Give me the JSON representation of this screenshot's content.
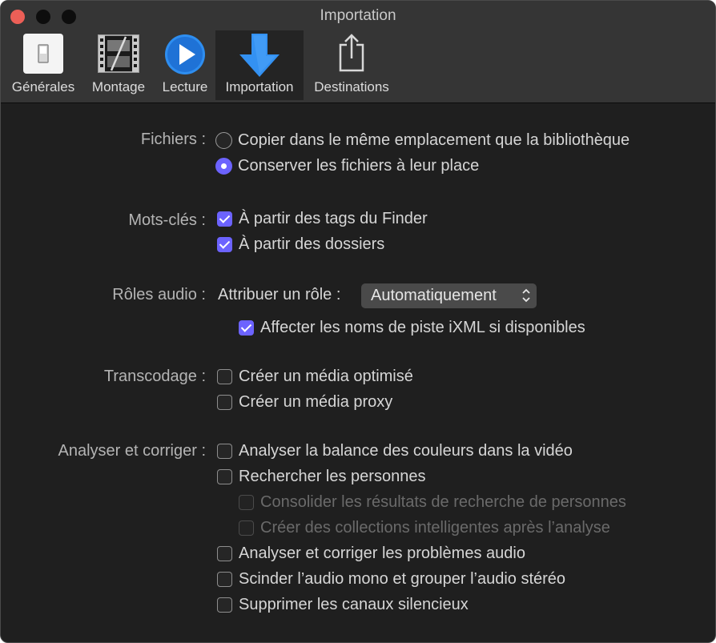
{
  "window": {
    "title": "Importation"
  },
  "toolbar": {
    "tabs": [
      {
        "label": "Générales"
      },
      {
        "label": "Montage"
      },
      {
        "label": "Lecture"
      },
      {
        "label": "Importation"
      },
      {
        "label": "Destinations"
      }
    ],
    "active_tab": "Importation"
  },
  "files": {
    "label": "Fichiers :",
    "options": [
      {
        "label": "Copier dans le même emplacement que la bibliothèque",
        "selected": false
      },
      {
        "label": "Conserver les fichiers à leur place",
        "selected": true
      }
    ]
  },
  "keywords": {
    "label": "Mots-clés :",
    "options": [
      {
        "label": "À partir des tags du Finder",
        "checked": true
      },
      {
        "label": "À partir des dossiers",
        "checked": true
      }
    ]
  },
  "audio_roles": {
    "label": "Rôles audio :",
    "assign_label": "Attribuer un rôle :",
    "assign_value": "Automatiquement",
    "ixml": {
      "label": "Affecter les noms de piste iXML si disponibles",
      "checked": true
    }
  },
  "transcode": {
    "label": "Transcodage :",
    "options": [
      {
        "label": "Créer un média optimisé",
        "checked": false
      },
      {
        "label": "Créer un média proxy",
        "checked": false
      }
    ]
  },
  "analyze": {
    "label": "Analyser et corriger :",
    "options": [
      {
        "label": "Analyser la balance des couleurs dans la vidéo",
        "checked": false,
        "enabled": true
      },
      {
        "label": "Rechercher les personnes",
        "checked": false,
        "enabled": true
      },
      {
        "label": "Consolider les résultats de recherche de personnes",
        "checked": false,
        "enabled": false
      },
      {
        "label": "Créer des collections intelligentes après l’analyse",
        "checked": false,
        "enabled": false
      },
      {
        "label": "Analyser et corriger les problèmes audio",
        "checked": false,
        "enabled": true
      },
      {
        "label": "Scinder l’audio mono et grouper l’audio stéréo",
        "checked": false,
        "enabled": true
      },
      {
        "label": "Supprimer les canaux silencieux",
        "checked": false,
        "enabled": true
      }
    ]
  },
  "colors": {
    "accent": "#6c63ff",
    "close": "#ec5f57",
    "icon_blue": "#2e8ef0"
  }
}
